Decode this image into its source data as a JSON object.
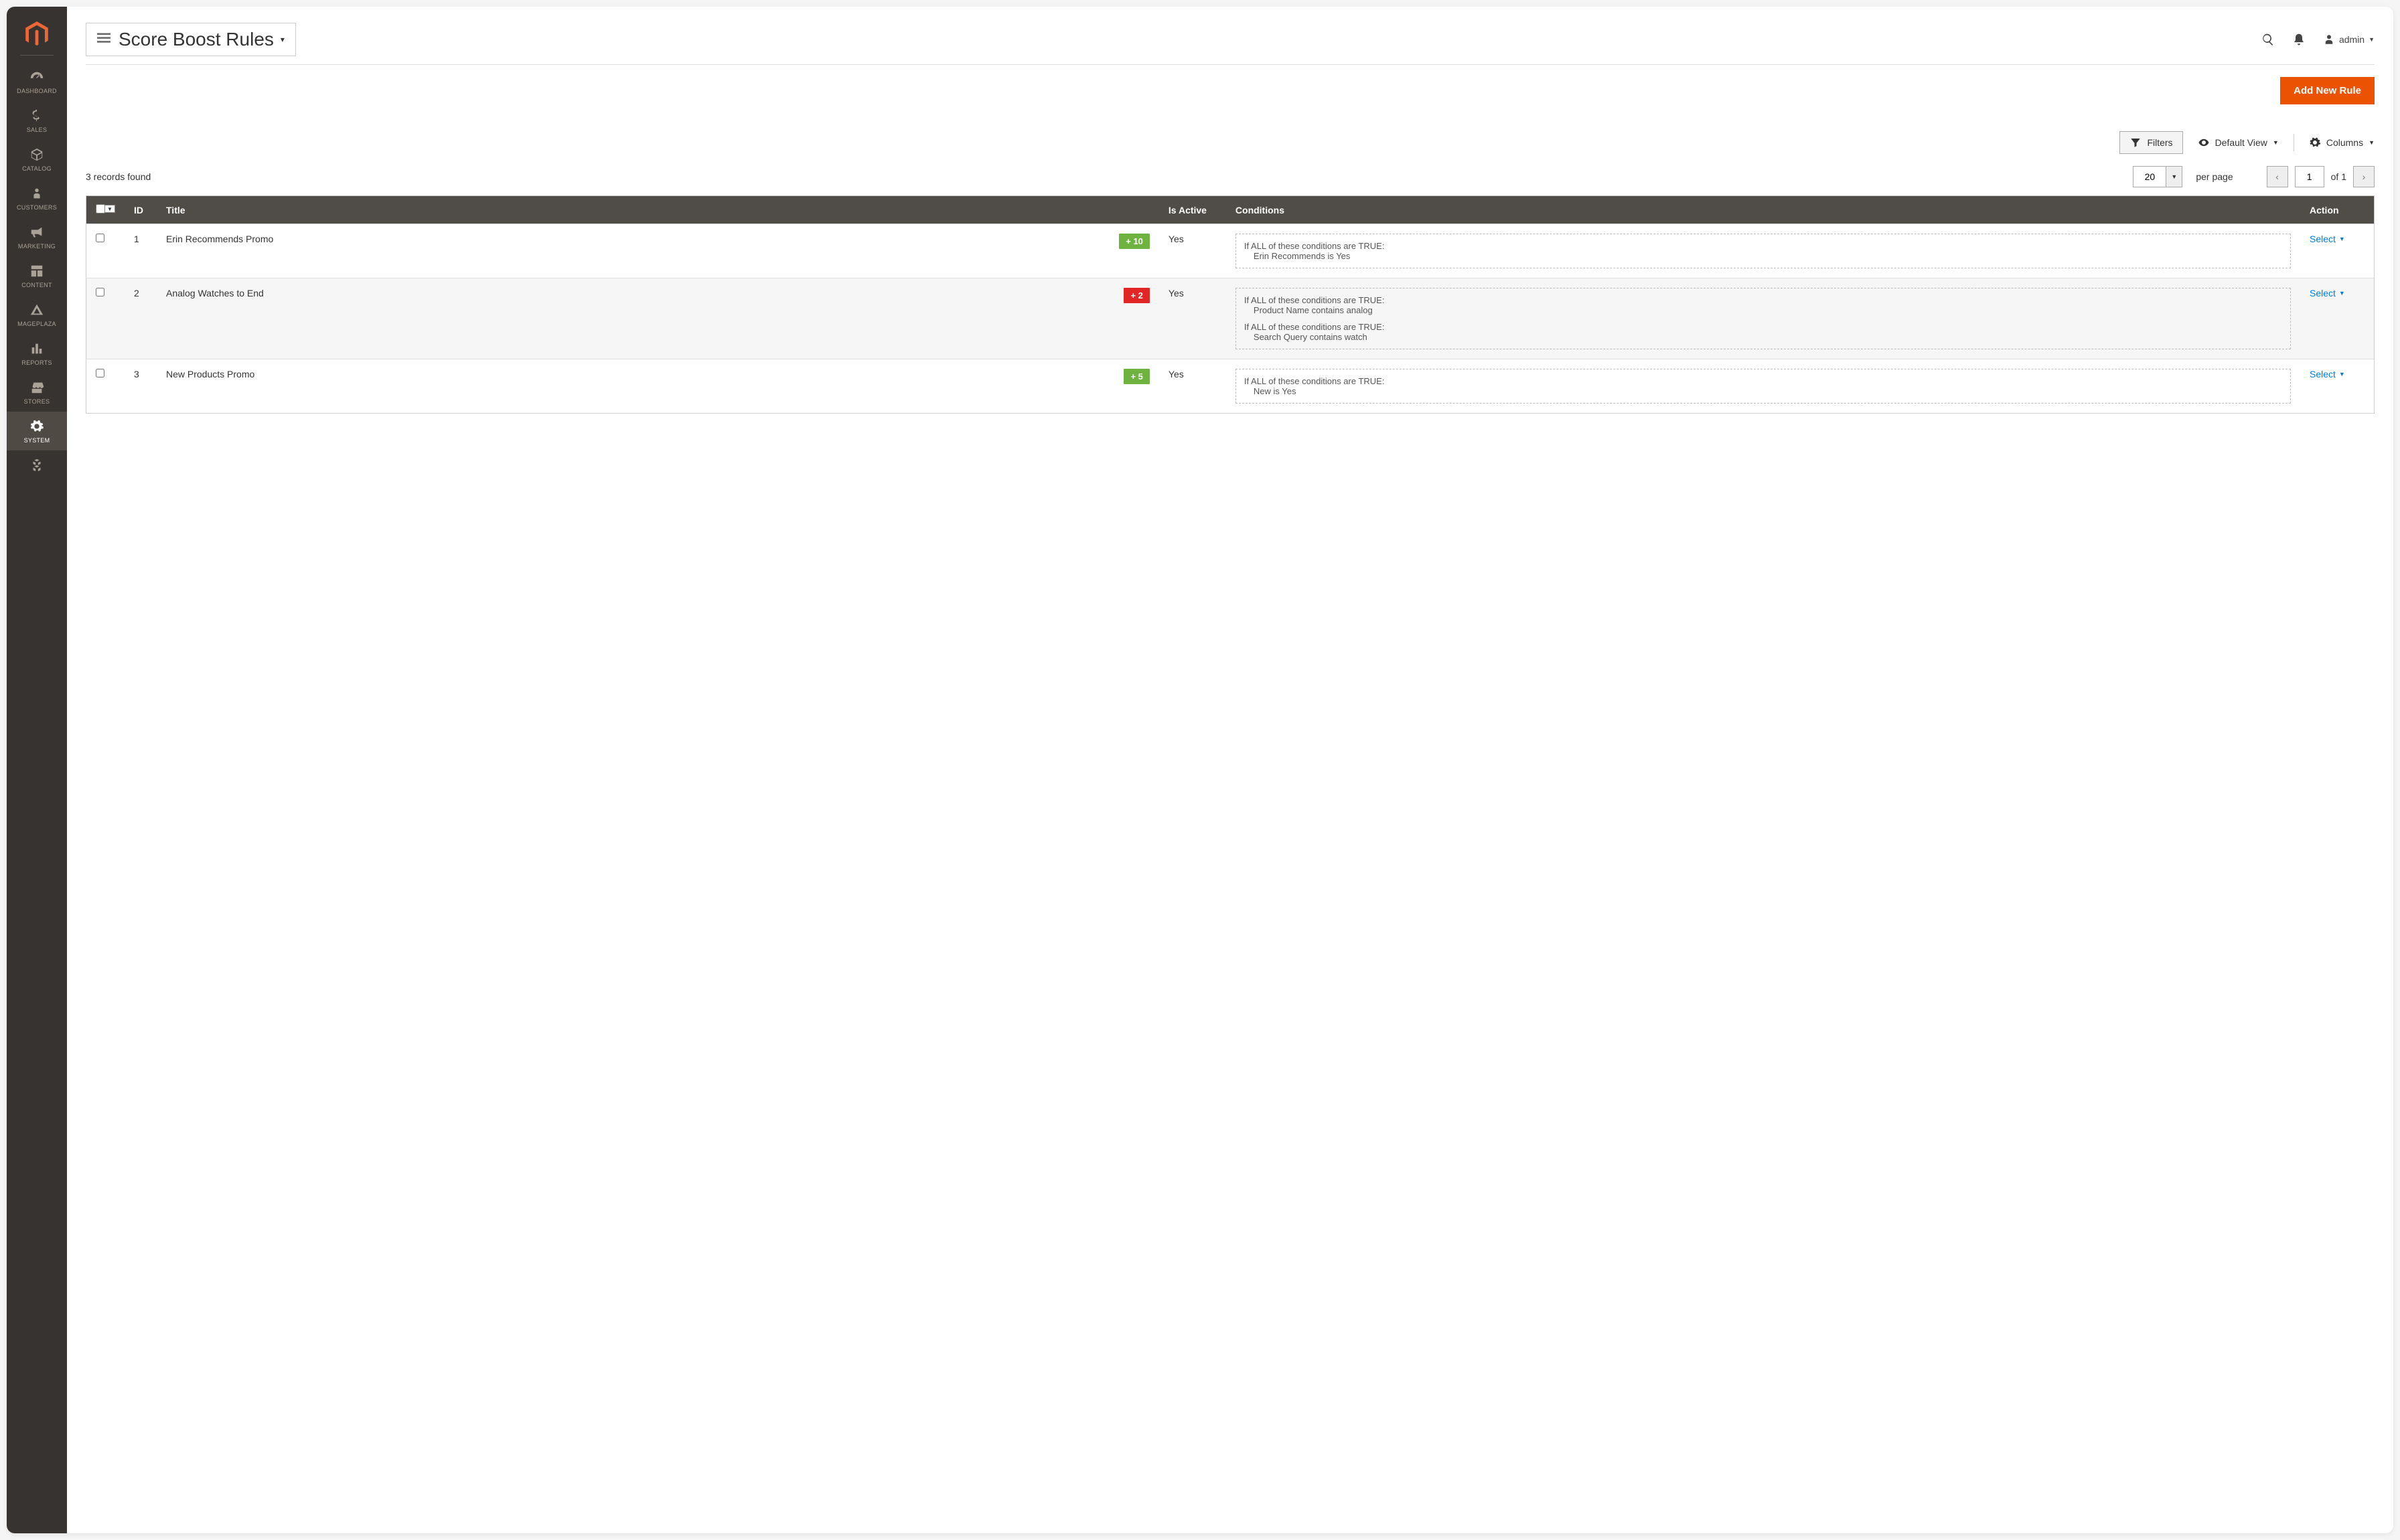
{
  "header": {
    "page_title": "Score Boost Rules",
    "user_label": "admin",
    "add_button": "Add New Rule"
  },
  "sidebar": {
    "items": [
      {
        "label": "DASHBOARD"
      },
      {
        "label": "SALES"
      },
      {
        "label": "CATALOG"
      },
      {
        "label": "CUSTOMERS"
      },
      {
        "label": "MARKETING"
      },
      {
        "label": "CONTENT"
      },
      {
        "label": "MAGEPLAZA"
      },
      {
        "label": "REPORTS"
      },
      {
        "label": "STORES"
      },
      {
        "label": "SYSTEM"
      }
    ]
  },
  "toolbar": {
    "filters": "Filters",
    "default_view": "Default View",
    "columns": "Columns"
  },
  "grid": {
    "records_found": "3 records found",
    "per_page_value": "20",
    "per_page_label": "per page",
    "page_current": "1",
    "page_total_label": "of 1",
    "columns": {
      "id": "ID",
      "title": "Title",
      "is_active": "Is Active",
      "conditions": "Conditions",
      "action": "Action"
    },
    "rows": [
      {
        "id": "1",
        "title": "Erin Recommends Promo",
        "score_text": "+ 10",
        "score_class": "score-green",
        "is_active": "Yes",
        "conditions": [
          {
            "line1": "If ALL of these conditions are TRUE:",
            "line2": "Erin Recommends is Yes"
          }
        ],
        "action": "Select"
      },
      {
        "id": "2",
        "title": "Analog Watches to End",
        "score_text": "+ 2",
        "score_class": "score-red",
        "is_active": "Yes",
        "conditions": [
          {
            "line1": "If ALL of these conditions are TRUE:",
            "line2": "Product Name contains analog"
          },
          {
            "line1": "If ALL of these conditions are TRUE:",
            "line2": "Search Query contains watch"
          }
        ],
        "action": "Select"
      },
      {
        "id": "3",
        "title": "New Products Promo",
        "score_text": "+ 5",
        "score_class": "score-green",
        "is_active": "Yes",
        "conditions": [
          {
            "line1": "If ALL of these conditions are TRUE:",
            "line2": "New is Yes"
          }
        ],
        "action": "Select"
      }
    ]
  }
}
